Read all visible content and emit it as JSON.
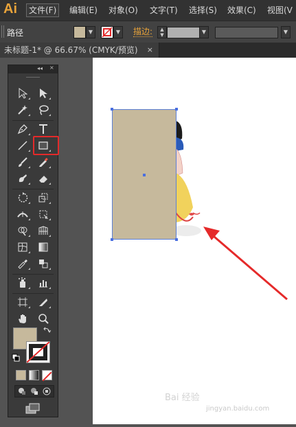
{
  "app": {
    "logo": "Ai"
  },
  "menu": [
    "文件(F)",
    "编辑(E)",
    "对象(O)",
    "文字(T)",
    "选择(S)",
    "效果(C)",
    "视图(V"
  ],
  "control_bar": {
    "object_label": "路径",
    "stroke_label": "描边:",
    "fill_color": "#c6b99c"
  },
  "document_tab": {
    "title": "未标题-1* @ 66.67% (CMYK/预览)",
    "close": "×"
  },
  "toolbox": {
    "header_collapse": "◂◂",
    "header_close": "×",
    "highlighted_tool": "rectangle-tool",
    "fill_swatch_color": "#c6b99c"
  },
  "canvas": {
    "shape_fill": "#c6b99c",
    "selection_color": "#4a6fe0"
  },
  "annotation": {
    "arrow_color": "#e52a2a"
  },
  "watermark": {
    "text": "Bai 经验",
    "url": "jingyan.baidu.com"
  }
}
